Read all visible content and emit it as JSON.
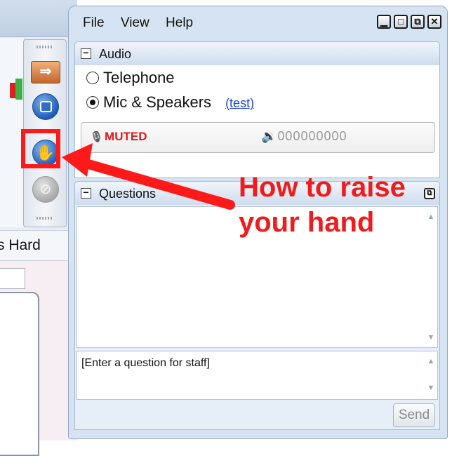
{
  "background_app": {
    "tab_label": "s Hard"
  },
  "window": {
    "menu": [
      "File",
      "View",
      "Help"
    ],
    "controls": {
      "minimize": "▁",
      "maximize": "□",
      "popout": "⧉",
      "close": "✕"
    }
  },
  "audio": {
    "title": "Audio",
    "options": [
      {
        "label": "Telephone",
        "selected": false
      },
      {
        "label": "Mic & Speakers",
        "selected": true
      }
    ],
    "test_link": "(test)",
    "mute_status": "MUTED",
    "volume_meter": "000000000"
  },
  "questions": {
    "title": "Questions",
    "input_placeholder": "[Enter a question for staff]",
    "send_label": "Send"
  },
  "annotation": {
    "line1": "How to raise",
    "line2": "your hand",
    "color": "#f01c1c"
  },
  "icons": {
    "toolbar": [
      "arrow-icon",
      "screen-share-icon",
      "raise-hand-icon",
      "mute-icon"
    ]
  }
}
